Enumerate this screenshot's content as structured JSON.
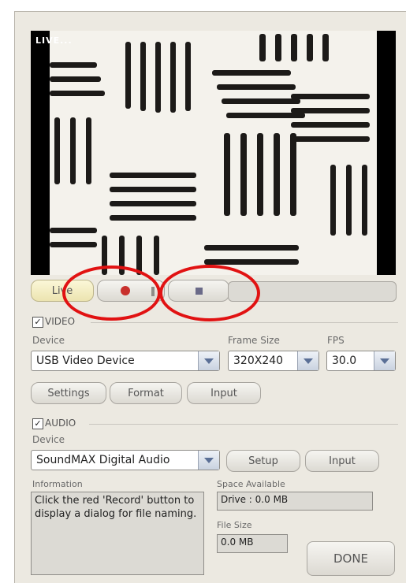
{
  "preview": {
    "live_badge": "LIVE..."
  },
  "transport": {
    "live_label": "Live"
  },
  "video": {
    "section_label": "VIDEO",
    "device_label": "Device",
    "device_value": "USB Video Device",
    "frame_size_label": "Frame Size",
    "frame_size_value": "320X240",
    "fps_label": "FPS",
    "fps_value": "30.0",
    "settings_label": "Settings",
    "format_label": "Format",
    "input_label": "Input"
  },
  "audio": {
    "section_label": "AUDIO",
    "device_label": "Device",
    "device_value": "SoundMAX Digital Audio",
    "setup_label": "Setup",
    "input_label": "Input"
  },
  "info": {
    "information_label": "Information",
    "information_text": "Click the red 'Record' button to display a dialog for file naming.",
    "space_label": "Space Available",
    "space_value": "Drive : 0.0 MB",
    "filesize_label": "File Size",
    "filesize_value": "0.0 MB",
    "done_label": "DONE"
  },
  "colors": {
    "highlight_ring": "#e11212",
    "record_dot": "#c8302c",
    "live_button": "#f4efc8"
  }
}
